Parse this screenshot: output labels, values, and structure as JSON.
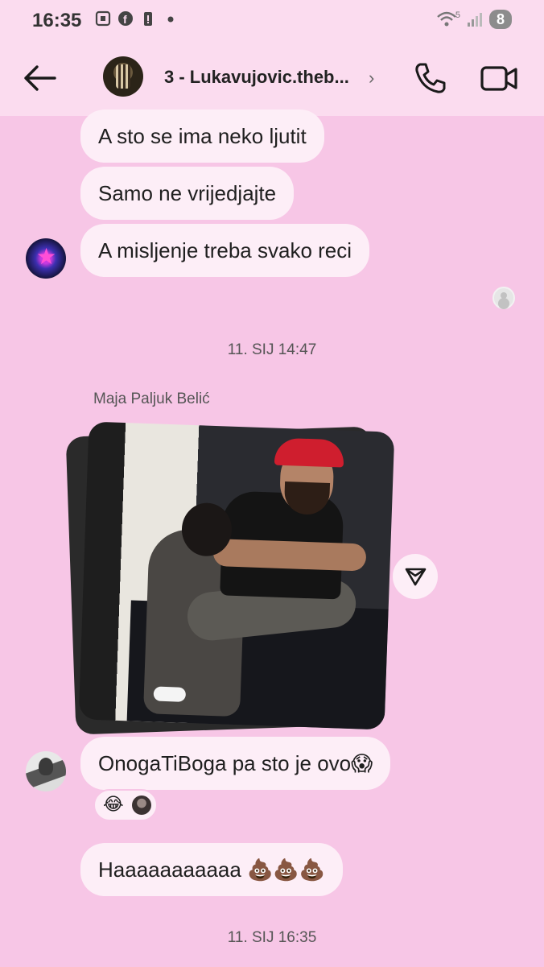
{
  "status_bar": {
    "time": "16:35",
    "battery": "8",
    "signal_label": "5"
  },
  "header": {
    "title": "3 - Lukavujovic.theb...",
    "chevron": "›"
  },
  "messages": [
    {
      "text": "A sto se ima neko ljutit"
    },
    {
      "text": "Samo ne vrijedjajte"
    },
    {
      "text": "A misljenje treba svako reci"
    }
  ],
  "timestamps": {
    "first": "11. SIJ 14:47",
    "second": "11. SIJ 16:35"
  },
  "sender": {
    "name": "Maja Paljuk Belić"
  },
  "later_messages": [
    {
      "text": "OnogaTiBoga pa sto je ovo😱"
    },
    {
      "text": "Haaaaaaaaaaa 💩💩💩"
    }
  ],
  "reactions": {
    "emoji": "😂"
  },
  "colors": {
    "background": "#f7c6e6",
    "bubble": "#fdeef7",
    "bar": "#fbdcef"
  },
  "icons": [
    "back-arrow-icon",
    "phone-icon",
    "video-camera-icon",
    "send-share-icon",
    "wifi-icon",
    "battery-icon"
  ]
}
